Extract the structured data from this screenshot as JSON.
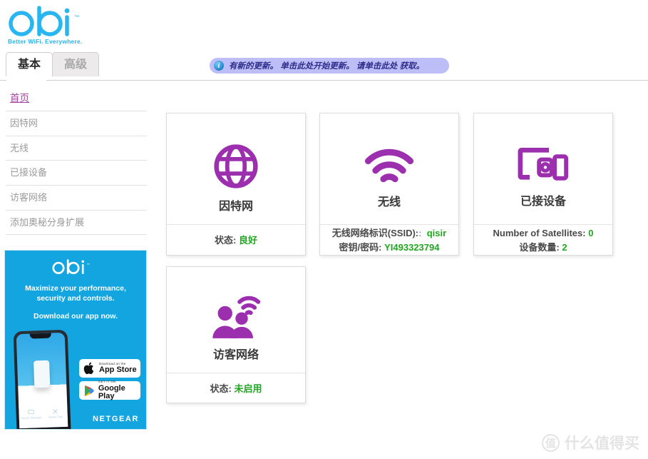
{
  "brand": {
    "logo_text": "orbi",
    "logo_tm": "™",
    "tagline": "Better WiFi. Everywhere."
  },
  "tabs": [
    {
      "label": "基本",
      "active": true
    },
    {
      "label": "高级",
      "active": false
    }
  ],
  "banner": {
    "icon": "info-icon",
    "text": "有新的更新。 单击此处开始更新。 请单击此处 获取。"
  },
  "sidebar": {
    "items": [
      {
        "label": "首页",
        "active": true
      },
      {
        "label": "因特网",
        "active": false
      },
      {
        "label": "无线",
        "active": false
      },
      {
        "label": "已接设备",
        "active": false
      },
      {
        "label": "访客网络",
        "active": false
      },
      {
        "label": "添加奥秘分身扩展",
        "active": false
      }
    ]
  },
  "promo": {
    "logo_text": "orbi",
    "headline_line1": "Maximize your performance,",
    "headline_line2": "security and controls.",
    "subline": "Download our app now.",
    "appstore_top": "Download on the",
    "appstore_name": "App Store",
    "googleplay_top": "GET IT ON",
    "googleplay_name": "Google Play",
    "brand": "NETGEAR",
    "phone_label_left": "Device Manager",
    "phone_label_right": "Speed Test"
  },
  "cards": {
    "internet": {
      "icon": "globe-icon",
      "title": "因特网",
      "status_label": "状态:",
      "status_value": "良好"
    },
    "wireless": {
      "icon": "wifi-icon",
      "title": "无线",
      "ssid_label": "无线网络标识(SSID):",
      "ssid_colon": ":",
      "ssid_value": "qisir",
      "password_label": "密钥/密码:",
      "password_value": "YI493323794"
    },
    "devices": {
      "icon": "devices-icon",
      "title": "已接设备",
      "satellites_label": "Number of Satellites:",
      "satellites_value": "0",
      "devices_label": "设备数量:",
      "devices_value": "2"
    },
    "guest": {
      "icon": "guest-network-icon",
      "title": "访客网络",
      "status_label": "状态:",
      "status_value": "未启用"
    }
  },
  "watermark": {
    "mark": "值",
    "text": "什么值得买"
  },
  "colors": {
    "brand_blue": "#13a5e0",
    "icon_purple": "#9b2fae",
    "active_link": "#a0409a",
    "status_green": "#22a522",
    "banner_bg": "#bdbdf7"
  }
}
